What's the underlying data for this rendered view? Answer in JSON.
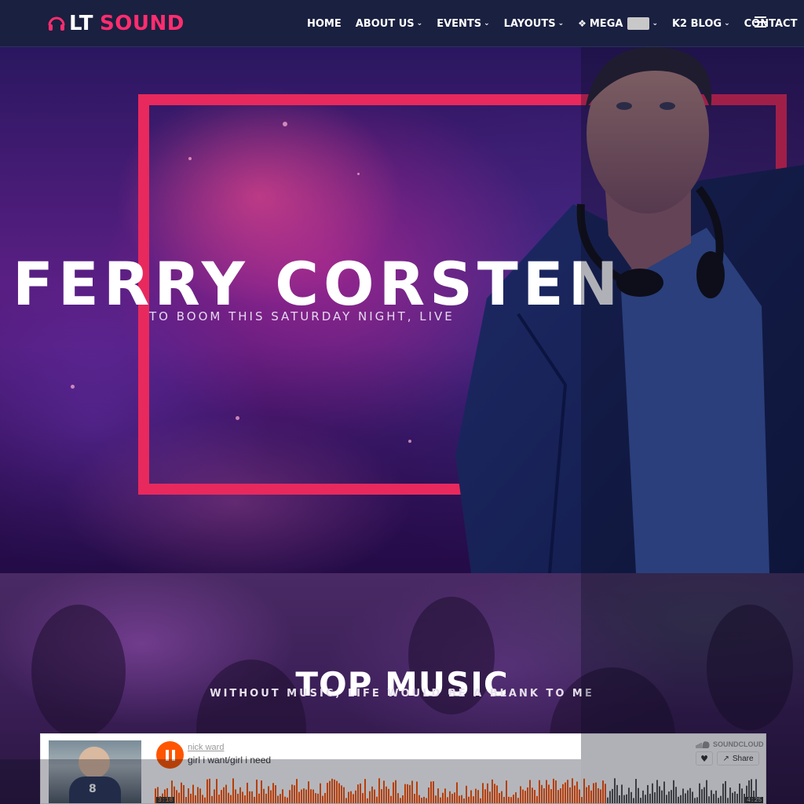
{
  "brand": {
    "lt": "LT",
    "sound": "SOUND",
    "accent": "#ff2d6f"
  },
  "nav": {
    "items": [
      {
        "label": "HOME",
        "chevron": false
      },
      {
        "label": "ABOUT US",
        "chevron": true
      },
      {
        "label": "EVENTS",
        "chevron": true
      },
      {
        "label": "LAYOUTS",
        "chevron": true
      },
      {
        "label": "MEGA",
        "chevron": true,
        "icon": "cog-icon",
        "badge": true
      },
      {
        "label": "K2 BLOG",
        "chevron": true
      },
      {
        "label": "CONTACT",
        "chevron": false
      }
    ],
    "menu_icon": "hamburger-icon"
  },
  "hero": {
    "title": "FERRY CORSTEN",
    "subtitle": "TO BOOM THIS SATURDAY NIGHT, LIVE",
    "frame_color": "#e8295d"
  },
  "music": {
    "title": "TOP MUSIC",
    "subtitle": "WITHOUT MUSIC, LIFE WOULD BE A BLANK TO ME"
  },
  "player": {
    "user": "nick ward",
    "track": "girl i want/girl i need",
    "brand": "SOUNDCLOUD",
    "share_label": "Share",
    "time_elapsed": "3:18",
    "time_total": "4:25",
    "progress": 0.75,
    "played_color": "#ff5500",
    "artwork_number": "8"
  }
}
